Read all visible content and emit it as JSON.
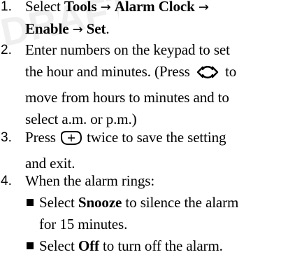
{
  "watermark_text": "DRAFT",
  "steps": [
    {
      "number": "1.",
      "line1_prefix": "Select ",
      "tools": "Tools",
      "arrow": "→",
      "alarm_clock": "Alarm Clock",
      "enable": "Enable",
      "set": "Set",
      "period": "."
    },
    {
      "number": "2.",
      "line1": "Enter numbers on the keypad to set",
      "line2_prefix": "the hour and minutes. (Press",
      "line2_suffix": "to",
      "line3": "move from hours to minutes and to",
      "line4": "select a.m. or p.m.)"
    },
    {
      "number": "3.",
      "line1_prefix": "Press",
      "line1_suffix": "twice to save the setting",
      "line2": "and exit."
    },
    {
      "number": "4.",
      "line1": "When the alarm rings:",
      "bullet1_prefix": "Select ",
      "bullet1_bold": "Snooze",
      "bullet1_suffix": " to silence the alarm",
      "bullet1_cont": "for 15 minutes.",
      "bullet2_prefix": "Select ",
      "bullet2_bold": "Off",
      "bullet2_suffix": " to turn off the alarm."
    }
  ],
  "icons": {
    "nav_key": "navigation-key-icon",
    "ok_key": "ok-key-icon"
  }
}
